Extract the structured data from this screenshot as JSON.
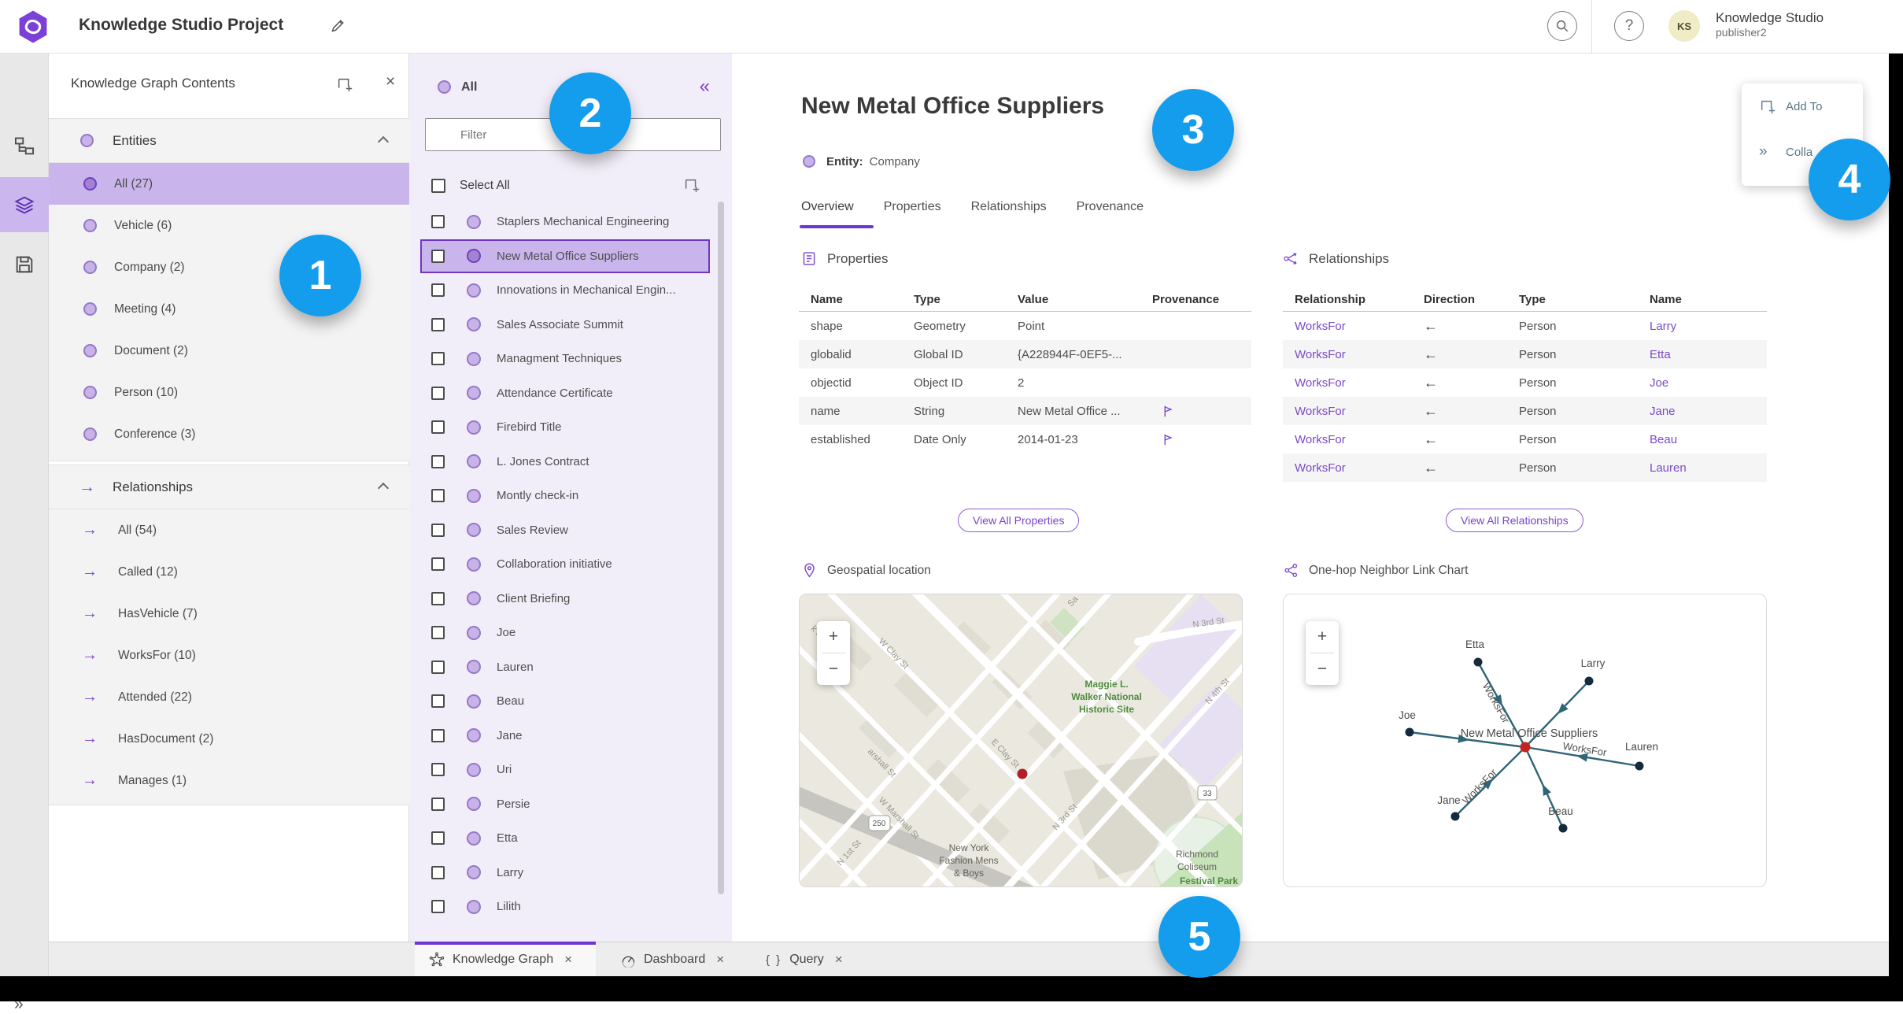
{
  "glyphs": {
    "close": "×",
    "collapse_left": "«",
    "expand_right": "»",
    "arrow_right": "→",
    "plus": "+",
    "minus": "−",
    "braces": "{ }"
  },
  "header": {
    "title": "Knowledge Studio Project",
    "account_name": "Knowledge Studio",
    "account_role": "publisher2",
    "avatar_initials": "KS"
  },
  "left_rail": {
    "icons": [
      "data-model",
      "layers",
      "save",
      "expand"
    ],
    "active_icon": "layers"
  },
  "contents_panel": {
    "title": "Knowledge Graph Contents",
    "entities": {
      "header": "Entities",
      "items": [
        "All (27)",
        "Vehicle (6)",
        "Company (2)",
        "Meeting (4)",
        "Document (2)",
        "Person (10)",
        "Conference (3)"
      ],
      "selected": "All (27)"
    },
    "relationships": {
      "header": "Relationships",
      "items": [
        "All (54)",
        "Called (12)",
        "HasVehicle (7)",
        "WorksFor (10)",
        "Attended (22)",
        "HasDocument (2)",
        "Manages (1)"
      ]
    }
  },
  "filter_panel": {
    "scope": "All",
    "placeholder": "Filter",
    "select_all": "Select All",
    "items": [
      "Staplers Mechanical Engineering",
      "New Metal Office Suppliers",
      "Innovations in Mechanical Engin...",
      "Sales Associate Summit",
      "Managment Techniques",
      "Attendance Certificate",
      "Firebird Title",
      "L. Jones Contract",
      "Montly check-in",
      "Sales Review",
      "Collaboration initiative",
      "Client Briefing",
      "Joe",
      "Lauren",
      "Beau",
      "Jane",
      "Uri",
      "Persie",
      "Etta",
      "Larry",
      "Lilith"
    ],
    "selected_item": "New Metal Office Suppliers"
  },
  "detail": {
    "title": "New Metal Office Suppliers",
    "entity_label": "Entity:",
    "entity_type": "Company",
    "tabs": [
      "Overview",
      "Properties",
      "Relationships",
      "Provenance"
    ],
    "active_tab": "Overview",
    "properties": {
      "heading": "Properties",
      "columns": [
        "Name",
        "Type",
        "Value",
        "Provenance"
      ],
      "rows": [
        {
          "name": "shape",
          "type": "Geometry",
          "value": "Point",
          "provenance": false
        },
        {
          "name": "globalid",
          "type": "Global ID",
          "value": "{A228944F-0EF5-...",
          "provenance": false
        },
        {
          "name": "objectid",
          "type": "Object ID",
          "value": "2",
          "provenance": false
        },
        {
          "name": "name",
          "type": "String",
          "value": "New Metal Office ...",
          "provenance": true
        },
        {
          "name": "established",
          "type": "Date Only",
          "value": "2014-01-23",
          "provenance": true
        }
      ],
      "view_all": "View All Properties"
    },
    "relationships": {
      "heading": "Relationships",
      "columns": [
        "Relationship",
        "Direction",
        "Type",
        "Name"
      ],
      "rows": [
        {
          "relationship": "WorksFor",
          "direction": "←",
          "type": "Person",
          "name": "Larry"
        },
        {
          "relationship": "WorksFor",
          "direction": "←",
          "type": "Person",
          "name": "Etta"
        },
        {
          "relationship": "WorksFor",
          "direction": "←",
          "type": "Person",
          "name": "Joe"
        },
        {
          "relationship": "WorksFor",
          "direction": "←",
          "type": "Person",
          "name": "Jane"
        },
        {
          "relationship": "WorksFor",
          "direction": "←",
          "type": "Person",
          "name": "Beau"
        },
        {
          "relationship": "WorksFor",
          "direction": "←",
          "type": "Person",
          "name": "Lauren"
        }
      ],
      "view_all": "View All Relationships"
    },
    "map": {
      "heading": "Geospatial location",
      "labels": {
        "historic_site_1": "Maggie L.",
        "historic_site_2": "Walker National",
        "historic_site_3": "Historic Site",
        "store_1": "New York",
        "store_2": "Fashion Mens",
        "store_3": "& Boys",
        "coliseum_1": "Richmond",
        "coliseum_2": "Coliseum",
        "park": "Festival Park",
        "st_w_clay": "W Clay St",
        "st_e_clay": "E Clay St",
        "st_marshall_partial": "arshall St",
        "st_w_marshall": "W Marshall St",
        "st_n1st": "N 1st St",
        "st_n3rd": "N 3rd St",
        "st_n3rd_top": "N 3rd St",
        "st_n4th": "N 4th St",
        "st_sa": "Sa",
        "st_k_rd": "k Rd",
        "shield_250": "250",
        "shield_33": "33"
      }
    },
    "link_chart": {
      "heading": "One-hop Neighbor Link Chart",
      "center_label": "New Metal Office Suppliers",
      "edge_label": "WorksFor",
      "nodes": [
        "Etta",
        "Larry",
        "Joe",
        "Lauren",
        "Jane",
        "Beau"
      ],
      "edges": [
        {
          "from": "Etta",
          "to": "New Metal Office Suppliers",
          "label": "WorksFor"
        },
        {
          "from": "Larry",
          "to": "New Metal Office Suppliers",
          "label": "WorksFor"
        },
        {
          "from": "Joe",
          "to": "New Metal Office Suppliers",
          "label": "WorksFor"
        },
        {
          "from": "Lauren",
          "to": "New Metal Office Suppliers",
          "label": "WorksFor"
        },
        {
          "from": "Jane",
          "to": "New Metal Office Suppliers",
          "label": "WorksFor"
        },
        {
          "from": "Beau",
          "to": "New Metal Office Suppliers",
          "label": "WorksFor"
        }
      ]
    }
  },
  "actions_popup": {
    "add_to": "Add To",
    "collapse": "Colla"
  },
  "bottom_tabs": {
    "items": [
      {
        "label": "Knowledge Graph",
        "active": true
      },
      {
        "label": "Dashboard",
        "active": false
      },
      {
        "label": "Query",
        "active": false
      }
    ]
  },
  "callouts": {
    "badges": [
      "1",
      "2",
      "3",
      "4",
      "5"
    ]
  }
}
